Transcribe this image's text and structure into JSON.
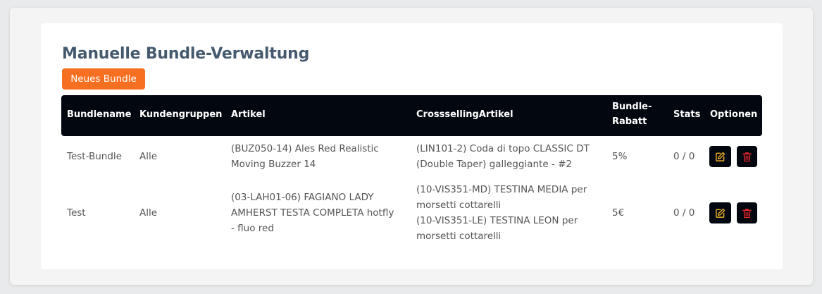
{
  "page": {
    "title": "Manuelle Bundle-Verwaltung",
    "new_button_label": "Neues Bundle"
  },
  "table": {
    "headers": {
      "bundlename": "Bundlename",
      "kundengruppen": "Kundengruppen",
      "artikel": "Artikel",
      "crossselling": "CrosssellingArtikel",
      "rabatt_line1": "Bundle-",
      "rabatt_line2": "Rabatt",
      "stats": "Stats",
      "optionen": "Optionen"
    },
    "rows": [
      {
        "name": "Test-Bundle",
        "kundengruppen": "Alle",
        "artikel": [
          "(BUZ050-14) Ales Red Realistic",
          "Moving Buzzer 14"
        ],
        "crossselling": [
          "(LIN101-2) Coda di topo CLASSIC DT",
          "(Double Taper) galleggiante - #2"
        ],
        "rabatt": "5%",
        "stats": "0 / 0"
      },
      {
        "name": "Test",
        "kundengruppen": "Alle",
        "artikel": [
          "(03-LAH01-06) FAGIANO LADY",
          "AMHERST TESTA COMPLETA hotfly",
          "- fluo red"
        ],
        "crossselling": [
          "(10-VIS351-MD) TESTINA MEDIA per",
          "morsetti cottarelli",
          "(10-VIS351-LE) TESTINA LEON per",
          "morsetti cottarelli"
        ],
        "rabatt": "5€",
        "stats": "0 / 0"
      }
    ]
  },
  "icons": {
    "edit": "edit-icon",
    "delete": "trash-icon"
  },
  "colors": {
    "accent": "#f76f21",
    "header_bg": "#03070f",
    "title": "#455a6f",
    "edit_icon": "#f5b62b",
    "delete_icon": "#e8262b"
  }
}
